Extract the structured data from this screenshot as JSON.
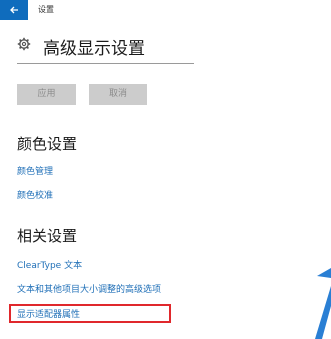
{
  "window": {
    "title": "设置",
    "back_icon": "back-arrow-icon"
  },
  "header": {
    "title": "高级显示设置",
    "icon": "gear-icon"
  },
  "buttons": {
    "apply_label": "应用",
    "cancel_label": "取消"
  },
  "color_settings": {
    "title": "颜色设置",
    "links": [
      "颜色管理",
      "颜色校准"
    ]
  },
  "related_settings": {
    "title": "相关设置",
    "links": [
      "ClearType 文本",
      "文本和其他项目大小调整的高级选项",
      "显示适配器属性"
    ]
  },
  "colors": {
    "accent": "#0f6cbd",
    "link": "#1f6fb7",
    "highlight": "#e0282c",
    "button_bg": "#cccccc"
  }
}
